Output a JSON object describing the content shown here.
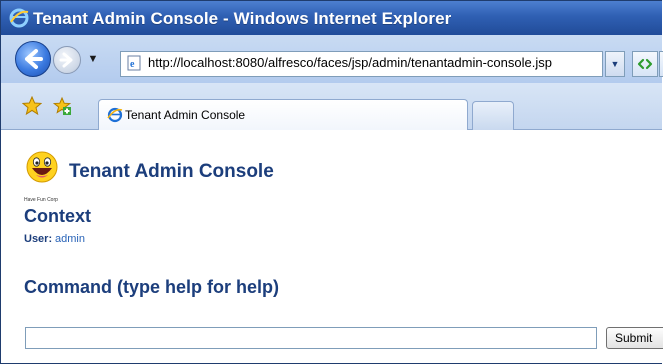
{
  "window": {
    "title": "Tenant Admin Console - Windows Internet Explorer"
  },
  "navigation": {
    "back_icon": "back-arrow-icon",
    "forward_icon": "forward-arrow-icon",
    "recent_pages_icon": "dropdown-arrow-icon",
    "address": "http://localhost:8080/alfresco/faces/jsp/admin/tenantadmin-console.jsp",
    "refresh_icon": "refresh-icon"
  },
  "tabs": {
    "favorites_icon": "favorites-star-icon",
    "add_favorite_icon": "add-favorite-icon",
    "active_tab_label": "Tenant Admin Console",
    "new_tab_icon": "new-tab-icon"
  },
  "page": {
    "logo_caption": "Have Fun Corp",
    "title": "Tenant Admin Console",
    "context_heading": "Context",
    "user_label": "User:",
    "user_value": "admin",
    "command_heading": "Command (type help for help)",
    "command_input_value": "",
    "submit_label": "Submit"
  },
  "colors": {
    "heading": "#1c3e7c",
    "link": "#2a64b8",
    "titlebar": "#2f5fb3"
  }
}
